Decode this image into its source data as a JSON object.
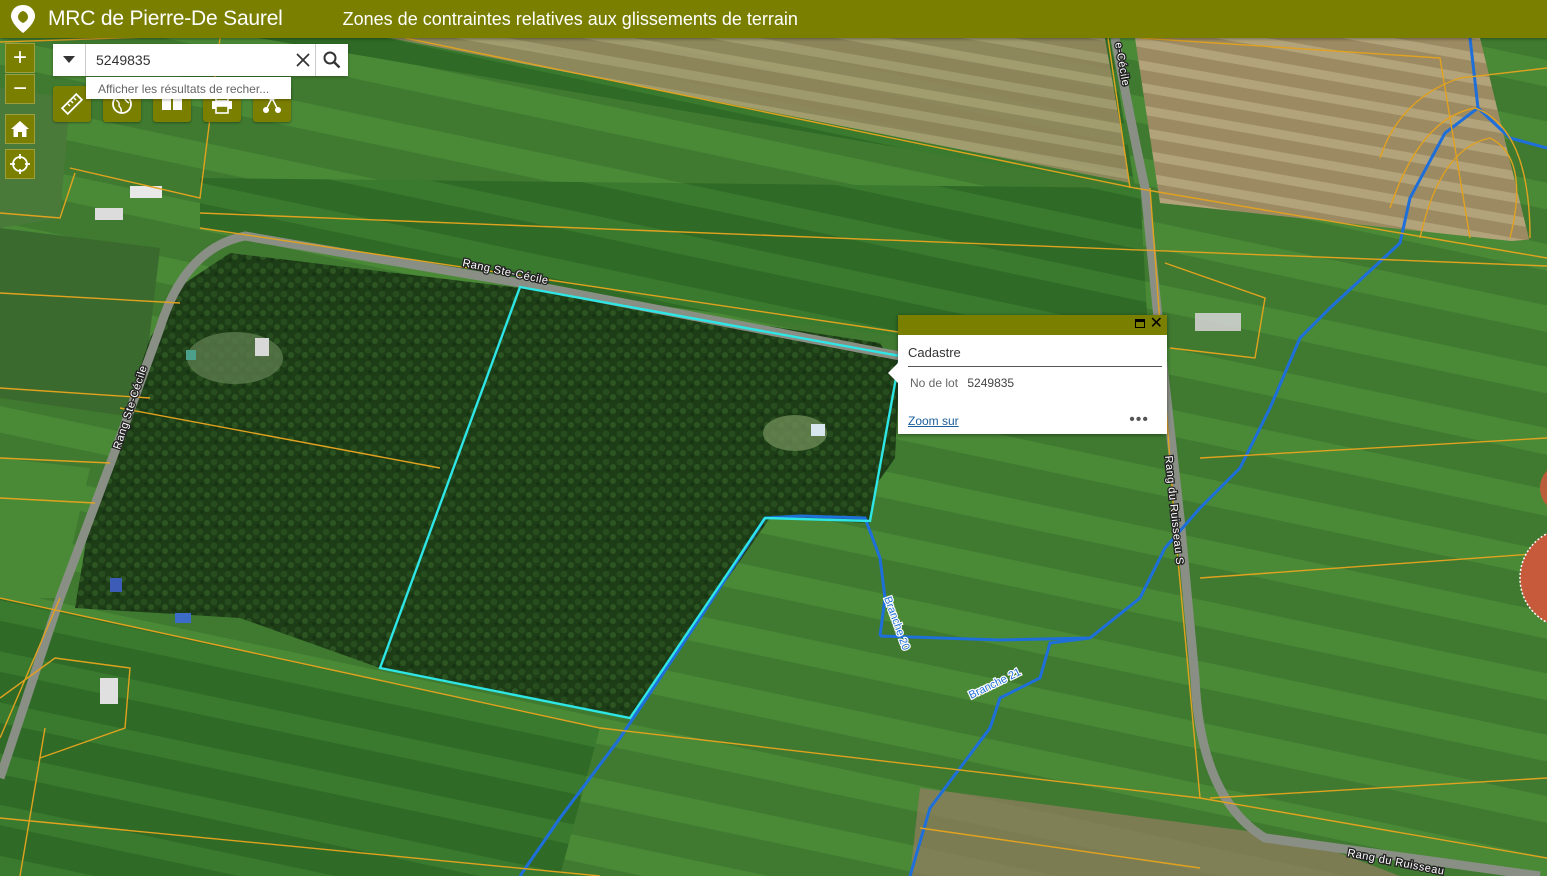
{
  "header": {
    "app_title": "MRC de Pierre-De Saurel",
    "subtitle": "Zones de contraintes relatives aux glissements de terrain",
    "logo_icon": "location-leaf-icon"
  },
  "map_controls": {
    "zoom_in": "+",
    "zoom_out": "−",
    "home_icon": "home-icon",
    "locate_icon": "locate-icon"
  },
  "search": {
    "value": "5249835",
    "suggestion": "Afficher les résultats de recher..."
  },
  "toolbar": {
    "tools": [
      "measure-icon",
      "basemap-gallery-icon",
      "layout-icon",
      "print-icon",
      "share-icon"
    ]
  },
  "popup": {
    "title": "Cadastre",
    "field_label": "No de lot",
    "field_value": "5249835",
    "zoom_link": "Zoom sur",
    "more": "•••"
  },
  "map_labels": {
    "road_1": "Rang  Ste-Cécile",
    "road_2": "Rang Ste-Cécile",
    "road_3": "e-Cécile",
    "road_4": "Rang du Ruisseau S",
    "road_5": "Rang du Ruisseau",
    "stream_1": "Branche 20",
    "stream_2": "Branche 21"
  },
  "colors": {
    "header": "#7b7f00",
    "selection": "#2ee6e6",
    "lot_lines": "#e1a21f",
    "streams": "#1e6fd9"
  }
}
